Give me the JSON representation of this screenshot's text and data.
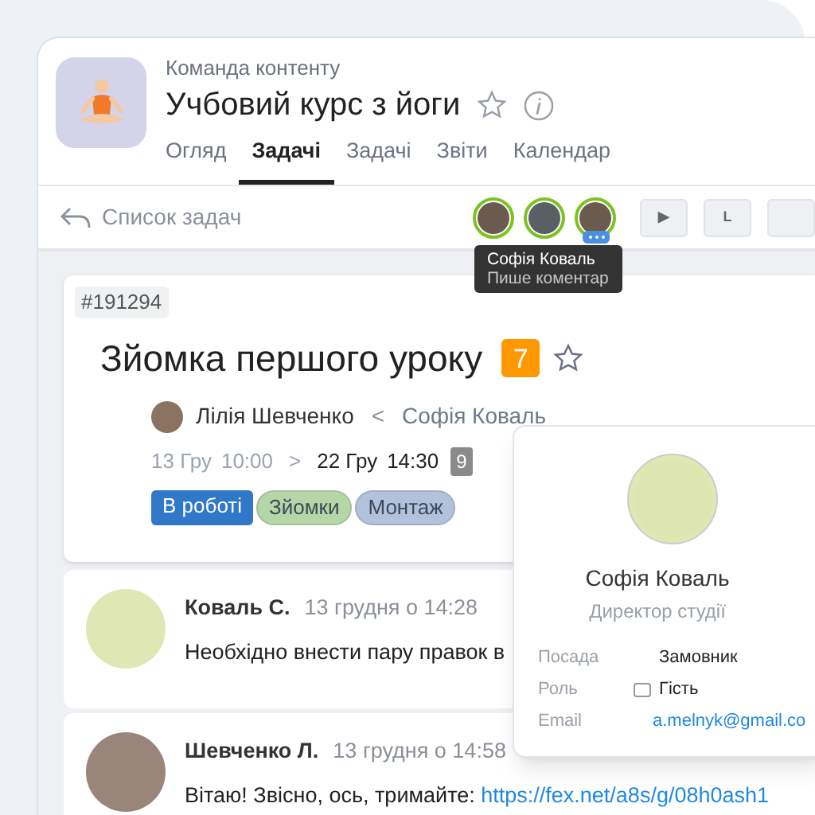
{
  "header": {
    "team": "Команда контенту",
    "title": "Учбовий курс з йоги"
  },
  "tabs": [
    {
      "label": "Огляд",
      "selected": false
    },
    {
      "label": "Задачі",
      "selected": true
    },
    {
      "label": "Задачі",
      "selected": false
    },
    {
      "label": "Звіти",
      "selected": false
    },
    {
      "label": "Календар",
      "selected": false
    }
  ],
  "toolbar": {
    "back_label": "Список задач",
    "members": [
      {
        "typing": false
      },
      {
        "typing": false
      },
      {
        "typing": true
      }
    ],
    "buttons": [
      {
        "kind": "text",
        "label": "▶"
      },
      {
        "kind": "text",
        "label": "L"
      },
      {
        "kind": "blank"
      }
    ]
  },
  "tooltip": {
    "name": "Софія Коваль",
    "status": "Пише коментар"
  },
  "task": {
    "id": "#191294",
    "title": "Зйомка першого уроку",
    "count": "7",
    "starred": false,
    "author": "Лілія Шевченко",
    "separator": "<",
    "assignee": "Софія Коваль",
    "start_date": "13 Гру",
    "start_time": "10:00",
    "arrow": ">",
    "end_date": "22 Гру",
    "end_time": "14:30",
    "duration": "9",
    "tags": [
      {
        "label": "В роботі",
        "color": "#3278c8"
      },
      {
        "label": "Зйомки",
        "color": "#b5d6a7"
      },
      {
        "label": "Монтаж",
        "color": "#b3c2dc"
      }
    ]
  },
  "comments": [
    {
      "author": "Коваль С.",
      "time": "13 грудня о 14:28",
      "text": "Необхідно внести пару правок в"
    },
    {
      "author": "Шевченко Л.",
      "time": "13 грудня о 14:58",
      "text": "Вітаю! Звісно, ось, тримайте:",
      "link": "https://fex.net/a8s/g/08h0ash1"
    }
  ],
  "profile": {
    "name": "Софія Коваль",
    "role": "Директор студії",
    "fields": [
      {
        "label": "Посада",
        "value": "Замовник",
        "kind": "text"
      },
      {
        "label": "Роль",
        "value": "Гість",
        "kind": "tagged"
      },
      {
        "label": "Email",
        "value": "a.melnyk@gmail.co",
        "kind": "link"
      }
    ]
  }
}
